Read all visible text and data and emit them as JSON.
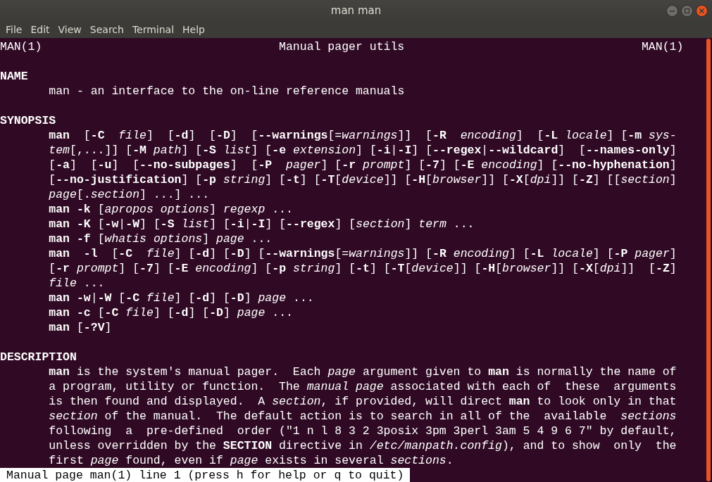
{
  "window": {
    "title": "man man"
  },
  "menu": [
    "File",
    "Edit",
    "View",
    "Search",
    "Terminal",
    "Help"
  ],
  "header": {
    "left": "MAN(1)",
    "center": "Manual pager utils",
    "right": "MAN(1)"
  },
  "sections": [
    {
      "heading": "NAME",
      "lines": [
        "man - an interface to the on-line reference manuals"
      ]
    },
    {
      "heading": "SYNOPSIS",
      "lines": [
        "**man**  [**-C**  *file*]  [**-d**]  [**-D**]  [**--warnings**[=*warnings*]]  [**-R**  *encoding*]  [**-L** *locale*] [**-m** *sys-*",
        "*tem*[,...]] [**-M** *path*] [**-S** *list*] [**-e** *extension*] [**-i**|**-I**] [**--regex**|**--wildcard**]  [**--names-only**]",
        "[**-a**]  [**-u**]  [**--no-subpages**]  [**-P**  *pager*] [**-r** *prompt*] [**-7**] [**-E** *encoding*] [**--no-hyphenation**]",
        "[**--no-justification**] [**-p** *string*] [**-t**] [**-T**[*device*]] [**-H**[*browser*]] [**-X**[*dpi*]] [**-Z**] [[*section*]",
        "*page*[.*section*] ...] ...",
        "**man** **-k** [*apropos* *options*] *regexp* ...",
        "**man** **-K** [**-w**|**-W**] [**-S** *list*] [**-i**|**-I**] [**--regex**] [*section*] *term* ...",
        "**man** **-f** [*whatis* *options*] *page* ...",
        "**man**  **-l**  [**-C**  *file*] [**-d**] [**-D**] [**--warnings**[=*warnings*]] [**-R** *encoding*] [**-L** *locale*] [**-P** *pager*]",
        "[**-r** *prompt*] [**-7**] [**-E** *encoding*] [**-p** *string*] [**-t**] [**-T**[*device*]] [**-H**[*browser*]] [**-X**[*dpi*]]  [**-Z**]",
        "*file* ...",
        "**man** **-w**|**-W** [**-C** *file*] [**-d**] [**-D**] *page* ...",
        "**man** **-c** [**-C** *file*] [**-d**] [**-D**] *page* ...",
        "**man** [**-?V**]"
      ]
    },
    {
      "heading": "DESCRIPTION",
      "lines": [
        "**man** is the system's manual pager.  Each *page* argument given to **man** is normally the name of",
        "a program, utility or function.  The *manual* *page* associated with each of  these  arguments",
        "is then found and displayed.  A *section*, if provided, will direct **man** to look only in that",
        "*section* of the manual.  The default action is to search in all of the  available  *sections*",
        "following  a  pre-defined  order (\"1 n l 8 3 2 3posix 3pm 3perl 3am 5 4 9 6 7\" by default,",
        "unless overridden by the **SECTION** directive in */etc/manpath.config*), and to show  only  the",
        "first *page* found, even if *page* exists in several *sections*."
      ]
    }
  ],
  "status_line": "Manual page man(1) line 1 (press h for help or q to quit)"
}
